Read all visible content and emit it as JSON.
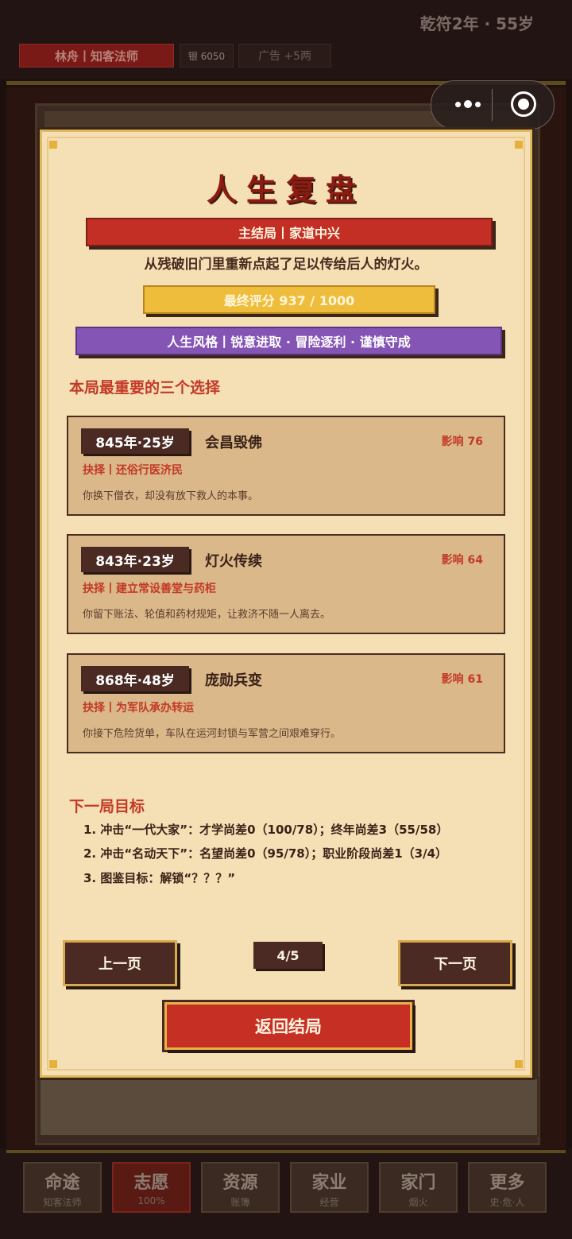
{
  "status": {
    "era": "乾符2年 · 55岁",
    "name_tag": "林舟丨知客法师",
    "silver": "银 6050",
    "ad_reward": "广告 +5两"
  },
  "modal": {
    "title": "人生复盘",
    "main_ending": "主结局丨家道中兴",
    "summary": "从残破旧门里重新点起了足以传给后人的灯火。",
    "final_score": "最终评分 937 / 1000",
    "life_style": "人生风格丨锐意进取 · 冒险逐利 · 谨慎守成",
    "choices_title": "本局最重要的三个选择",
    "choices": [
      {
        "date": "845年·25岁",
        "event": "会昌毁佛",
        "impact": "影响 76",
        "choice": "抉择丨还俗行医济民",
        "desc": "你换下僧衣，却没有放下救人的本事。"
      },
      {
        "date": "843年·23岁",
        "event": "灯火传续",
        "impact": "影响 64",
        "choice": "抉择丨建立常设善堂与药柜",
        "desc": "你留下账法、轮值和药材规矩，让救济不随一人离去。"
      },
      {
        "date": "868年·48岁",
        "event": "庞勋兵变",
        "impact": "影响 61",
        "choice": "抉择丨为军队承办转运",
        "desc": "你接下危险货单，车队在运河封锁与军营之间艰难穿行。"
      }
    ],
    "next_title": "下一局目标",
    "goals": [
      "1.  冲击“一代大家”：才学尚差0（100/78）；终年尚差3（55/58）",
      "2.  冲击“名动天下”：名望尚差0（95/78）；职业阶段尚差1（3/4）",
      "3.  图鉴目标：解锁“？？？”"
    ],
    "prev_label": "上一页",
    "page_indicator": "4/5",
    "next_label": "下一页",
    "return_label": "返回结局"
  },
  "nav": [
    {
      "main": "命途",
      "sub": "知客法师"
    },
    {
      "main": "志愿",
      "sub": "100%"
    },
    {
      "main": "资源",
      "sub": "账簿"
    },
    {
      "main": "家业",
      "sub": "经营"
    },
    {
      "main": "家门",
      "sub": "烟火"
    },
    {
      "main": "更多",
      "sub": "史·危·人"
    }
  ],
  "colors": {
    "accent_red": "#c62f24",
    "gold": "#efbd3c",
    "purple": "#8455b5",
    "parchment": "#f5dfb5",
    "dark_brown": "#4a2a22"
  }
}
